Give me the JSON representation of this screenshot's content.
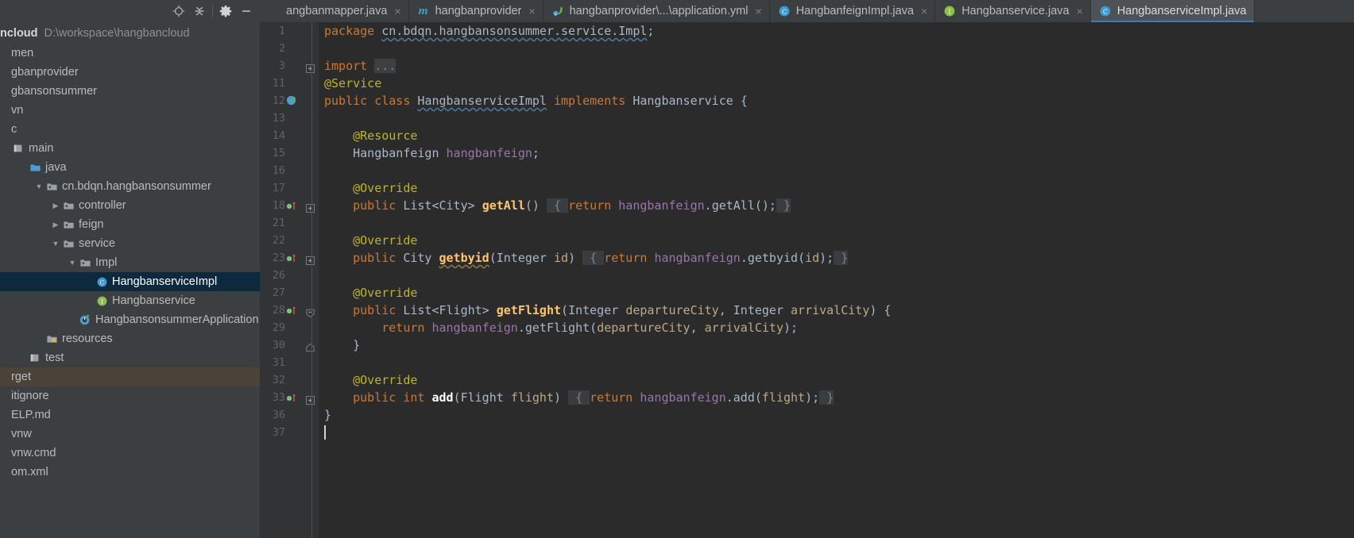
{
  "toolbar": {
    "buttons": [
      {
        "name": "locate-icon",
        "title": "Select Opened File"
      },
      {
        "name": "collapse-all-icon",
        "title": "Collapse All"
      },
      {
        "name": "settings-gear-icon",
        "title": "Settings"
      },
      {
        "name": "hide-icon",
        "title": "Hide"
      }
    ]
  },
  "tabs": [
    {
      "label": "angbanmapper.java",
      "icon": "java-class-icon",
      "active": false,
      "close": "×"
    },
    {
      "label": "hangbanprovider",
      "icon": "maven-module-icon",
      "active": false,
      "close": "×"
    },
    {
      "label": "hangbanprovider\\...\\application.yml",
      "icon": "spring-yaml-icon",
      "active": false,
      "close": "×"
    },
    {
      "label": "HangbanfeignImpl.java",
      "icon": "java-class-icon",
      "active": false,
      "close": "×"
    },
    {
      "label": "Hangbanservice.java",
      "icon": "java-interface-icon",
      "active": false,
      "close": "×"
    },
    {
      "label": "HangbanserviceImpl.java",
      "icon": "java-class-icon",
      "active": true,
      "close": "×"
    }
  ],
  "project": {
    "name": "ncloud",
    "path": "D:\\workspace\\hangbancloud",
    "tree": [
      {
        "label": "men",
        "indent": 0,
        "arrow": "none",
        "icon": "none",
        "state": "normal"
      },
      {
        "label": "gbanprovider",
        "indent": 0,
        "arrow": "none",
        "icon": "none",
        "state": "normal"
      },
      {
        "label": "gbansonsummer",
        "indent": 0,
        "arrow": "none",
        "icon": "none",
        "state": "normal"
      },
      {
        "label": "vn",
        "indent": 0,
        "arrow": "none",
        "icon": "none",
        "state": "normal"
      },
      {
        "label": "c",
        "indent": 0,
        "arrow": "none",
        "icon": "none",
        "state": "normal"
      },
      {
        "label": "main",
        "indent": 0,
        "arrow": "none",
        "icon": "module-icon",
        "state": "normal"
      },
      {
        "label": "java",
        "indent": 1,
        "arrow": "none",
        "icon": "source-root-icon",
        "state": "normal"
      },
      {
        "label": "cn.bdqn.hangbansonsummer",
        "indent": 2,
        "arrow": "expanded",
        "icon": "package-icon",
        "state": "normal"
      },
      {
        "label": "controller",
        "indent": 3,
        "arrow": "collapsed",
        "icon": "package-icon",
        "state": "normal"
      },
      {
        "label": "feign",
        "indent": 3,
        "arrow": "collapsed",
        "icon": "package-icon",
        "state": "normal"
      },
      {
        "label": "service",
        "indent": 3,
        "arrow": "expanded",
        "icon": "package-icon",
        "state": "normal"
      },
      {
        "label": "Impl",
        "indent": 4,
        "arrow": "expanded",
        "icon": "package-icon",
        "state": "normal"
      },
      {
        "label": "HangbanserviceImpl",
        "indent": 5,
        "arrow": "none",
        "icon": "java-class-icon",
        "state": "selected"
      },
      {
        "label": "Hangbanservice",
        "indent": 5,
        "arrow": "none",
        "icon": "java-interface-icon",
        "state": "normal"
      },
      {
        "label": "HangbansonsummerApplication",
        "indent": 4,
        "arrow": "none",
        "icon": "spring-boot-icon",
        "state": "normal"
      },
      {
        "label": "resources",
        "indent": 2,
        "arrow": "none",
        "icon": "resource-root-icon",
        "state": "normal"
      },
      {
        "label": "test",
        "indent": 1,
        "arrow": "none",
        "icon": "module-icon",
        "state": "normal"
      },
      {
        "label": "rget",
        "indent": 0,
        "arrow": "none",
        "icon": "none",
        "state": "target-hl"
      },
      {
        "label": "itignore",
        "indent": 0,
        "arrow": "none",
        "icon": "none",
        "state": "normal"
      },
      {
        "label": "ELP.md",
        "indent": 0,
        "arrow": "none",
        "icon": "none",
        "state": "normal"
      },
      {
        "label": "vnw",
        "indent": 0,
        "arrow": "none",
        "icon": "none",
        "state": "normal"
      },
      {
        "label": "vnw.cmd",
        "indent": 0,
        "arrow": "none",
        "icon": "none",
        "state": "normal"
      },
      {
        "label": "om.xml",
        "indent": 0,
        "arrow": "none",
        "icon": "none",
        "state": "normal"
      }
    ]
  },
  "editor": {
    "filename": "HangbanserviceImpl.java",
    "lines": [
      {
        "num": "1",
        "gutter_mark": "none",
        "fold": "none",
        "html": "<span class=\"kw\">package</span> <span class=\"id wavy\">cn.bdqn.hangbansonsummer.service.Impl</span><span class=\"pun\">;</span>"
      },
      {
        "num": "2",
        "gutter_mark": "none",
        "fold": "none",
        "html": ""
      },
      {
        "num": "3",
        "gutter_mark": "none",
        "fold": "plus",
        "html": "<span class=\"kw\">import</span> <span class=\"fold\">...</span>"
      },
      {
        "num": "11",
        "gutter_mark": "none",
        "fold": "none",
        "html": "<span class=\"ann\">@Service</span>"
      },
      {
        "num": "12",
        "gutter_mark": "spring-bean",
        "fold": "none",
        "html": "<span class=\"kw\">public</span> <span class=\"kw\">class</span> <span class=\"id wavy\">HangbanserviceImpl</span> <span class=\"kw\">implements</span> <span class=\"id\">Hangbanservice</span> <span class=\"pun\">{</span>"
      },
      {
        "num": "13",
        "gutter_mark": "none",
        "fold": "none",
        "html": ""
      },
      {
        "num": "14",
        "gutter_mark": "none",
        "fold": "none",
        "html": "    <span class=\"ann\">@Resource</span>"
      },
      {
        "num": "15",
        "gutter_mark": "none",
        "fold": "none",
        "html": "    <span class=\"id\">Hangbanfeign</span> <span class=\"fld\">hangbanfeign</span><span class=\"pun\">;</span>"
      },
      {
        "num": "16",
        "gutter_mark": "none",
        "fold": "none",
        "html": ""
      },
      {
        "num": "17",
        "gutter_mark": "none",
        "fold": "none",
        "html": "    <span class=\"ann\">@Override</span>"
      },
      {
        "num": "18",
        "gutter_mark": "override",
        "fold": "plus",
        "html": "    <span class=\"kw\">public</span> <span class=\"id\">List&lt;City&gt;</span> <span class=\"mthb\">getAll</span><span class=\"pun\">()</span> <span class=\"foldbrace\"> <span class=\"dim\">{</span> </span><span class=\"kw\">return</span> <span class=\"fld\">hangbanfeign</span><span class=\"pun\">.</span><span class=\"id\">getAll</span><span class=\"pun\">();</span><span class=\"foldbrace\"> <span class=\"dim\">}</span></span>"
      },
      {
        "num": "21",
        "gutter_mark": "none",
        "fold": "none",
        "html": ""
      },
      {
        "num": "22",
        "gutter_mark": "none",
        "fold": "none",
        "html": "    <span class=\"ann\">@Override</span>"
      },
      {
        "num": "23",
        "gutter_mark": "override",
        "fold": "plus",
        "html": "    <span class=\"kw\">public</span> <span class=\"id\">City</span> <span class=\"mthb wavy-w\">getbyid</span><span class=\"pun\">(</span><span class=\"id\">Integer</span> <span class=\"par\">id</span><span class=\"pun\">)</span> <span class=\"foldbrace\"> <span class=\"dim\">{</span> </span><span class=\"kw\">return</span> <span class=\"fld\">hangbanfeign</span><span class=\"pun\">.</span><span class=\"id\">getbyid</span><span class=\"pun\">(</span><span class=\"par\">id</span><span class=\"pun\">);</span><span class=\"foldbrace\"> <span class=\"dim\">}</span></span>"
      },
      {
        "num": "26",
        "gutter_mark": "none",
        "fold": "none",
        "html": ""
      },
      {
        "num": "27",
        "gutter_mark": "none",
        "fold": "none",
        "html": "    <span class=\"ann\">@Override</span>"
      },
      {
        "num": "28",
        "gutter_mark": "override",
        "fold": "minus",
        "html": "    <span class=\"kw\">public</span> <span class=\"id\">List&lt;Flight&gt;</span> <span class=\"mthb\">getFlight</span><span class=\"pun\">(</span><span class=\"id\">Integer</span> <span class=\"par\">departureCity</span><span class=\"pun\">,</span> <span class=\"id\">Integer</span> <span class=\"par\">arrivalCity</span><span class=\"pun\">) {</span>"
      },
      {
        "num": "29",
        "gutter_mark": "none",
        "fold": "none",
        "html": "        <span class=\"kw\">return</span> <span class=\"fld\">hangbanfeign</span><span class=\"pun\">.</span><span class=\"id\">getFlight</span><span class=\"pun\">(</span><span class=\"par\">departureCity</span><span class=\"pun\">,</span> <span class=\"par\">arrivalCity</span><span class=\"pun\">);</span>"
      },
      {
        "num": "30",
        "gutter_mark": "none",
        "fold": "end",
        "html": "    <span class=\"pun\">}</span>"
      },
      {
        "num": "31",
        "gutter_mark": "none",
        "fold": "none",
        "html": ""
      },
      {
        "num": "32",
        "gutter_mark": "none",
        "fold": "none",
        "html": "    <span class=\"ann\">@Override</span>"
      },
      {
        "num": "33",
        "gutter_mark": "override",
        "fold": "plus",
        "html": "    <span class=\"kw\">public</span> <span class=\"kw\">int</span> <span class=\"idb\">add</span><span class=\"pun\">(</span><span class=\"id\">Flight</span> <span class=\"par\">flight</span><span class=\"pun\">)</span> <span class=\"foldbrace\"> <span class=\"dim\">{</span> </span><span class=\"kw\">return</span> <span class=\"fld\">hangbanfeign</span><span class=\"pun\">.</span><span class=\"id\">add</span><span class=\"pun\">(</span><span class=\"par\">flight</span><span class=\"pun\">);</span><span class=\"foldbrace\"> <span class=\"dim\">}</span></span>"
      },
      {
        "num": "36",
        "gutter_mark": "none",
        "fold": "none",
        "html": "<span class=\"pun\">}</span>"
      },
      {
        "num": "37",
        "gutter_mark": "none",
        "fold": "none",
        "html": ""
      }
    ],
    "caret_line_index": 23
  },
  "colors": {
    "editor_bg": "#2b2b2b",
    "gutter_bg": "#313335",
    "panel_bg": "#3c3f41",
    "tab_active_bg": "#4e5254",
    "tab_underline": "#3d7ab5",
    "selection_bg": "#0d293e",
    "target_highlight_bg": "#4b423a",
    "keyword": "#cc7832",
    "annotation": "#bbb529",
    "field": "#9876aa",
    "method": "#ffc66d",
    "parameter": "#bcaa88",
    "default_text": "#a9b7c6"
  }
}
